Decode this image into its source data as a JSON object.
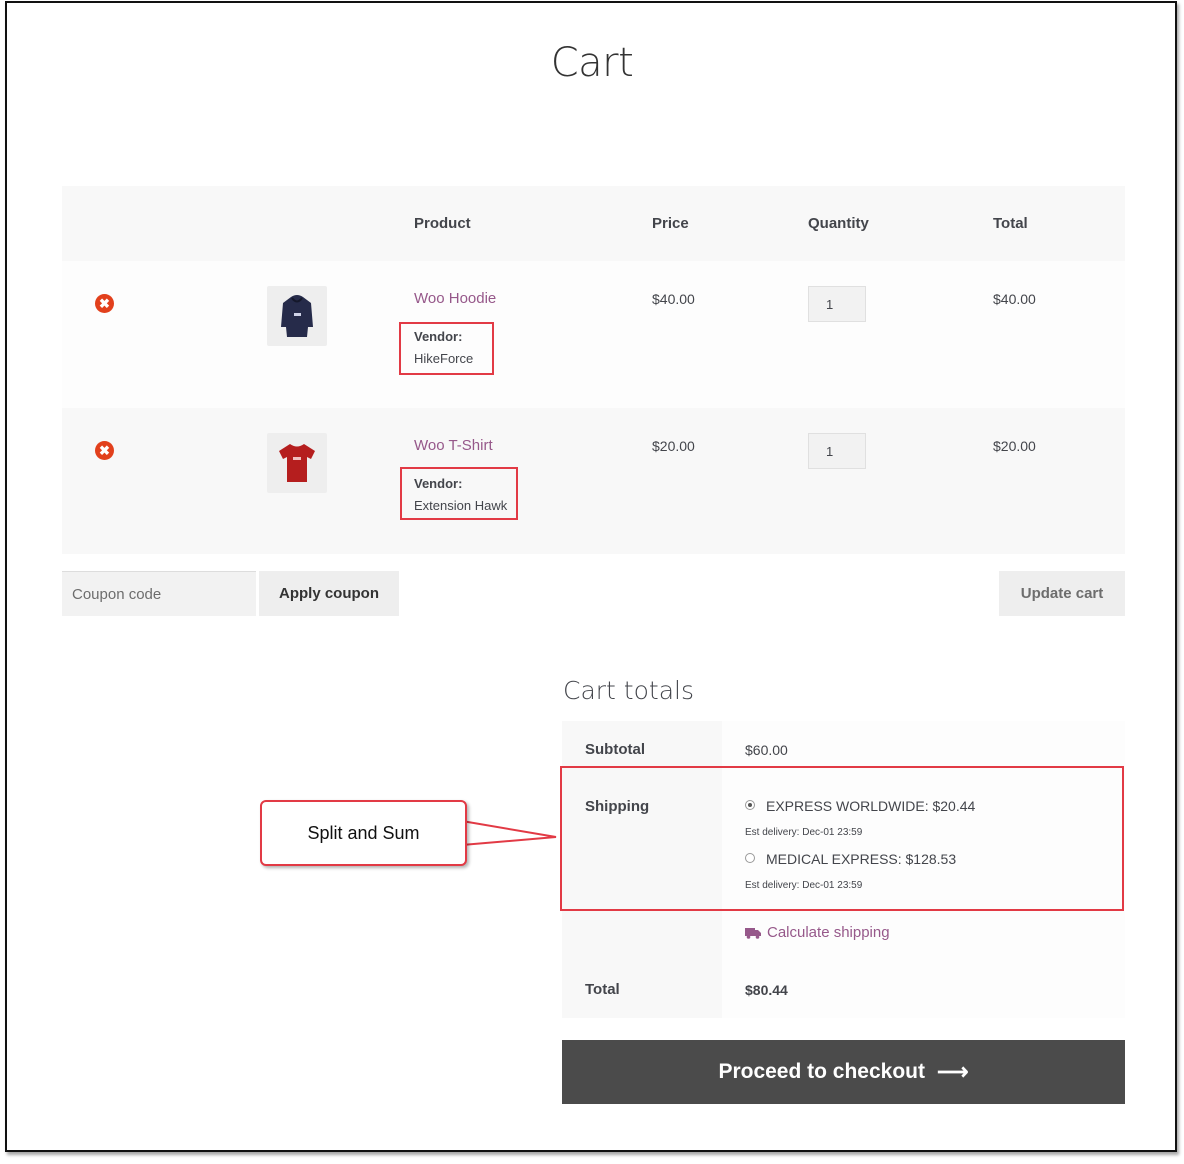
{
  "page": {
    "title": "Cart"
  },
  "table": {
    "headers": {
      "product": "Product",
      "price": "Price",
      "quantity": "Quantity",
      "total": "Total"
    },
    "remove_symbol": "✖",
    "rows": [
      {
        "product": "Woo Hoodie",
        "vendor_label": "Vendor:",
        "vendor": "HikeForce",
        "price": "$40.00",
        "quantity": "1",
        "total": "$40.00"
      },
      {
        "product": "Woo T-Shirt",
        "vendor_label": "Vendor:",
        "vendor": "Extension Hawk",
        "price": "$20.00",
        "quantity": "1",
        "total": "$20.00"
      }
    ]
  },
  "coupon": {
    "placeholder": "Coupon code",
    "apply_label": "Apply coupon"
  },
  "update_label": "Update cart",
  "totals": {
    "title": "Cart totals",
    "subtotal_label": "Subtotal",
    "subtotal": "$60.00",
    "shipping_label": "Shipping",
    "shipping_options": [
      {
        "name": "EXPRESS WORLDWIDE: $20.44",
        "est": "Est delivery: Dec-01 23:59",
        "checked": true
      },
      {
        "name": "MEDICAL EXPRESS: $128.53",
        "est": "Est delivery: Dec-01 23:59",
        "checked": false
      }
    ],
    "calculate_label": "Calculate shipping",
    "total_label": "Total",
    "total": "$80.44"
  },
  "checkout": {
    "label": "Proceed to checkout",
    "arrow": "⟶"
  },
  "annotation": {
    "callout_text": "Split and Sum"
  },
  "colors": {
    "link": "#96588a",
    "remove": "#e2401c",
    "annotation": "#e23a45",
    "checkout_bg": "#4b4b4b"
  },
  "icons": {
    "remove": "remove-circle-icon",
    "truck": "truck-icon",
    "arrow": "arrow-right-icon"
  }
}
